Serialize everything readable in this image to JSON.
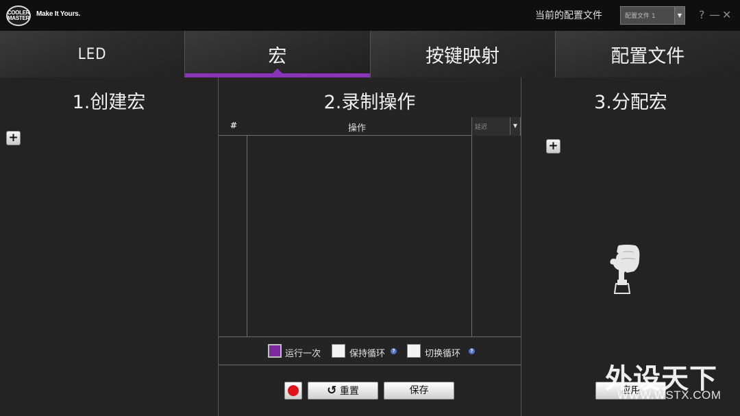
{
  "brand": {
    "logo_line1": "COOLER",
    "logo_line2": "MASTER",
    "tagline": "Make It Yours."
  },
  "header": {
    "profile_label": "当前的配置文件",
    "profile_value": "配置文件 1",
    "help": "?",
    "minimize": "—",
    "close": "✕"
  },
  "tabs": [
    {
      "label": "LED",
      "active": false
    },
    {
      "label": "宏",
      "active": true
    },
    {
      "label": "按键映射",
      "active": false
    },
    {
      "label": "配置文件",
      "active": false
    }
  ],
  "create": {
    "title": "1.创建宏",
    "add": "+"
  },
  "record": {
    "title": "2.录制操作",
    "col_number": "#",
    "col_action": "操作",
    "delay_value": "延迟",
    "options": [
      {
        "label": "运行一次",
        "checked": true,
        "help": false
      },
      {
        "label": "保持循环",
        "checked": false,
        "help": true
      },
      {
        "label": "切换循环",
        "checked": false,
        "help": true
      }
    ],
    "help_glyph": "?",
    "reset_label": "重置",
    "reset_icon": "↺",
    "save_label": "保存"
  },
  "assign": {
    "title": "3.分配宏",
    "add": "+",
    "apply_label": "应用"
  },
  "watermark": {
    "title": "外设天下",
    "url": "WWW.WSTX.COM"
  },
  "colors": {
    "accent": "#8a34b8",
    "record": "#e0131c",
    "help": "#5571c9"
  }
}
